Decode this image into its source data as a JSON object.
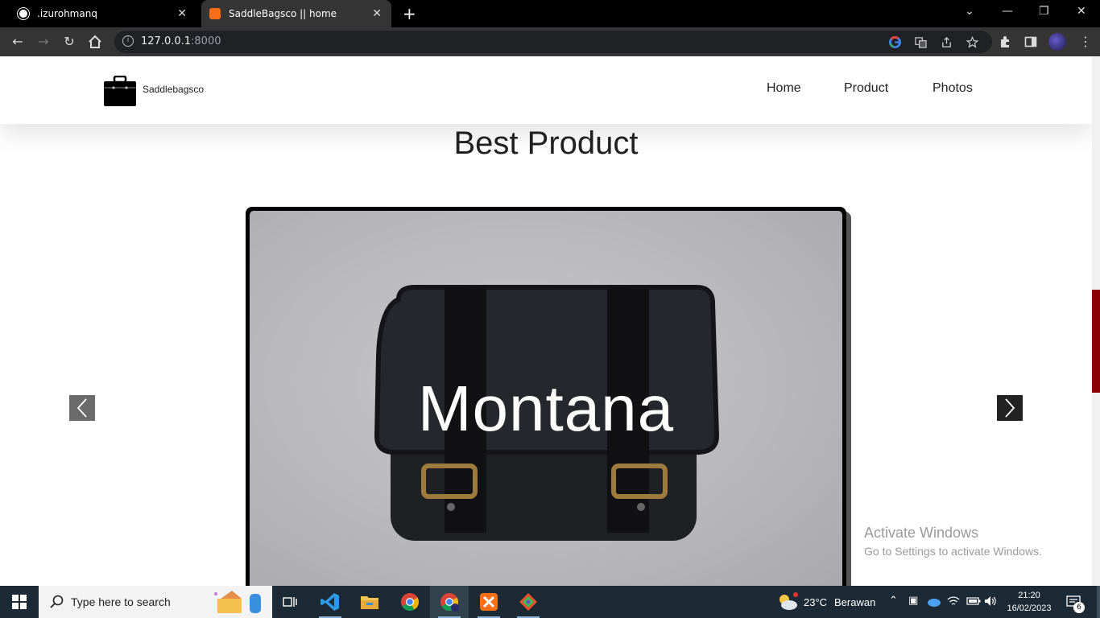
{
  "browser": {
    "tabs": [
      {
        "title": ".izurohmanq",
        "active": false
      },
      {
        "title": "SaddleBagsco || home",
        "active": true
      }
    ],
    "url_host": "127.0.0.1",
    "url_port": ":8000"
  },
  "site": {
    "brand": "Saddlebagsco",
    "menu": [
      "Home",
      "Product",
      "Photos"
    ],
    "section_title": "Best Product",
    "slide_title": "Montana"
  },
  "os": {
    "watermark_title": "Activate Windows",
    "watermark_sub": "Go to Settings to activate Windows.",
    "search_placeholder": "Type here to search",
    "weather_temp": "23°C",
    "weather_desc": "Berawan",
    "time": "21:20",
    "date": "16/02/2023",
    "notifications": "6"
  },
  "colors": {
    "scroll_accent": "#8b0000",
    "tab_favicon_xampp": "#f96e16"
  }
}
